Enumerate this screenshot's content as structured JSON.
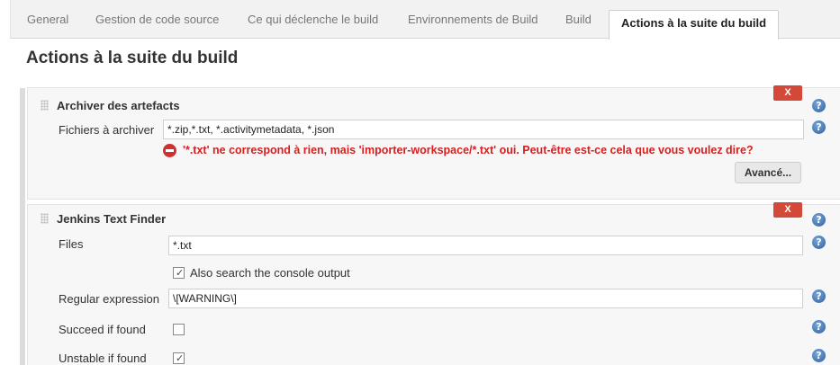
{
  "tabs": [
    {
      "label": "General"
    },
    {
      "label": "Gestion de code source"
    },
    {
      "label": "Ce qui déclenche le build"
    },
    {
      "label": "Environnements de Build"
    },
    {
      "label": "Build"
    },
    {
      "label": "Actions à la suite du build"
    }
  ],
  "page_title": "Actions à la suite du build",
  "archiver": {
    "title": "Archiver des artefacts",
    "delete_label": "X",
    "files_label": "Fichiers à archiver",
    "files_value": "*.zip,*.txt, *.activitymetadata, *.json",
    "error_text": "'*.txt' ne correspond à rien, mais 'importer-workspace/*.txt' oui. Peut-être est-ce cela que vous voulez dire?",
    "advanced_button": "Avancé..."
  },
  "text_finder": {
    "title": "Jenkins Text Finder",
    "delete_label": "X",
    "files_label": "Files",
    "files_value": "*.txt",
    "console_label": "Also search the console output",
    "console_checked": true,
    "regex_label": "Regular expression",
    "regex_value": "\\[WARNING\\]",
    "succeed_label": "Succeed if found",
    "succeed_checked": false,
    "unstable_label": "Unstable if found",
    "unstable_checked": true
  },
  "colors": {
    "error": "#d81e1e",
    "delete_button": "#d24939",
    "help_icon": "#2f5f9e"
  },
  "icons": {
    "help": "help-icon",
    "error": "error-icon",
    "drag": "drag-handle-icon"
  }
}
